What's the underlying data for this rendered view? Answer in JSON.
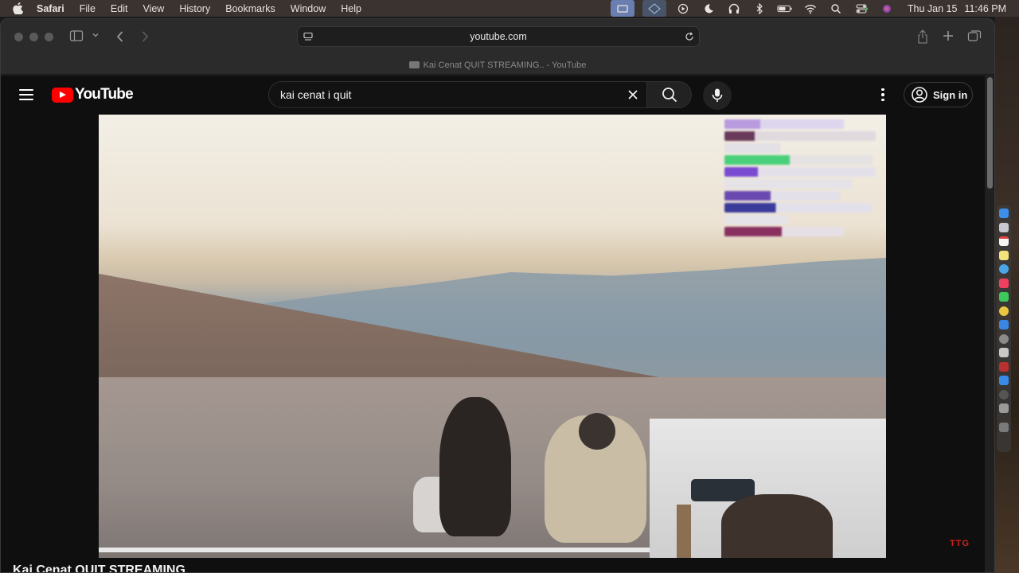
{
  "menubar": {
    "app_name": "Safari",
    "items": [
      "File",
      "Edit",
      "View",
      "History",
      "Bookmarks",
      "Window",
      "Help"
    ],
    "status_icons": [
      "screen-mirror-icon",
      "vpn-icon",
      "play-icon",
      "moon-icon",
      "headphones-icon",
      "bluetooth-icon",
      "battery-icon",
      "wifi-icon",
      "search-icon",
      "control-center-icon",
      "siri-icon"
    ],
    "date": "Thu Jan 15",
    "time": "11:46 PM"
  },
  "browser": {
    "address": "youtube.com",
    "tab_title": "Kai Cenat QUIT STREAMING.. - YouTube"
  },
  "youtube": {
    "logo_text": "YouTube",
    "search_value": "kai cenat i quit",
    "sign_in_label": "Sign in",
    "video_title": "Kai Cenat QUIT STREAMING",
    "watermark": "TTG"
  },
  "colors": {
    "brand_red": "#ff0000",
    "page_bg": "#0f0f0f"
  }
}
